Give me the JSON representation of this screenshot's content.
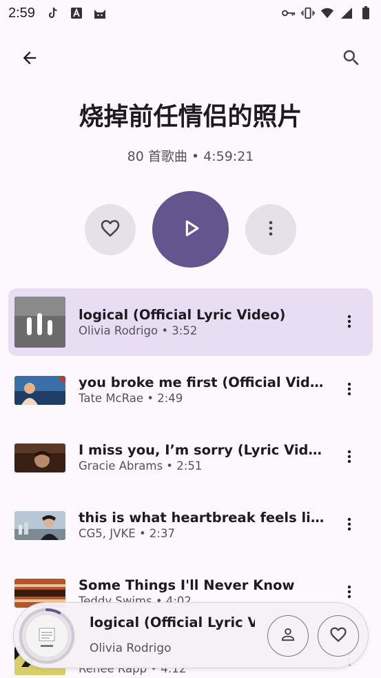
{
  "status_bar": {
    "time": "2:59",
    "left_icons": [
      "tiktok-icon",
      "app-a-icon",
      "cat-icon"
    ],
    "right_icons": [
      "key-icon",
      "vibrate-icon",
      "wifi-icon",
      "signal-icon",
      "battery-icon"
    ]
  },
  "top_bar": {
    "back_icon": "arrow-back-icon",
    "search_icon": "search-icon"
  },
  "playlist": {
    "title": "烧掉前任情侣的照片",
    "subtitle": "80 首歌曲 • 4:59:21"
  },
  "actions": {
    "like_icon": "heart-outline-icon",
    "play_icon": "play-icon",
    "more_icon": "more-vert-icon"
  },
  "songs": [
    {
      "title": "logical (Official Lyric Video)",
      "subtitle": "Olivia Rodrigo • 3:52",
      "playing": true
    },
    {
      "title": "you broke me first (Official Video)",
      "subtitle": "Tate McRae • 2:49"
    },
    {
      "title": "I miss you, I’m sorry (Lyric Video)",
      "subtitle": "Gracie Abrams • 2:51"
    },
    {
      "title": "this is what heartbreak feels lik…",
      "subtitle": "CG5, JVKE • 2:37"
    },
    {
      "title": "Some Things I'll Never Know",
      "subtitle": "Teddy Swims • 4:02"
    },
    {
      "title": "",
      "subtitle": "Renee Rapp • 4:12"
    }
  ],
  "mini_player": {
    "title": "logical (Official Lyric V",
    "artist": "Olivia Rodrigo",
    "progress": 0.08,
    "colors": {
      "accent": "#65558F",
      "active_row": "#E9DDF4"
    }
  }
}
